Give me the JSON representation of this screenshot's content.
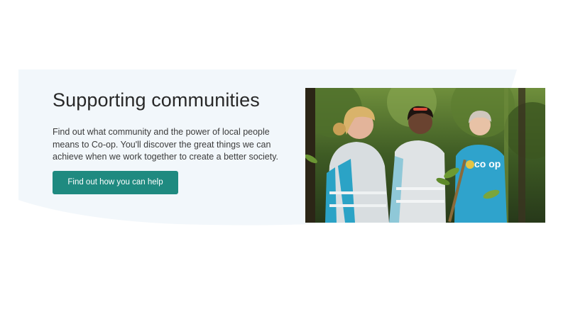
{
  "section": {
    "title": "Supporting communities",
    "description": "Find out what community and the power of local people means to Co-op. You'll discover the great things we can achieve when we work together to create a better society.",
    "cta_label": "Find out how you can help"
  },
  "photo": {
    "shirt_logo_text": "co op"
  },
  "colors": {
    "background_shape": "#f2f7fb",
    "button": "#1f8a80",
    "title": "#282828"
  }
}
